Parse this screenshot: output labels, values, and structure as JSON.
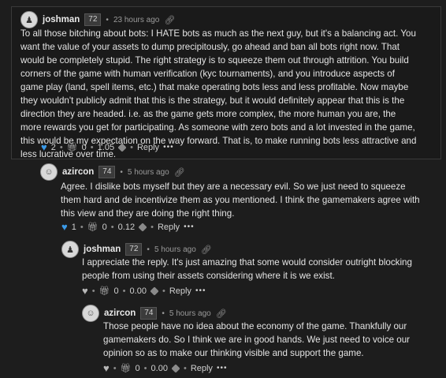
{
  "comments": [
    {
      "author": "joshman",
      "reputation": "72",
      "time": "23 hours ago",
      "body": "To all those bitching about bots: I HATE bots as much as the next guy, but it's a balancing act. You want the value of your assets to dump precipitously, go ahead and ban all bots right now. That would be completely stupid. The right strategy is to squeeze them out through attrition. You build corners of the game with human verification (kyc tournaments), and you introduce aspects of game play (land, spell items, etc.) that make operating bots less and less profitable. Now maybe they wouldn't publicly admit that this is the strategy, but it would definitely appear that this is the direction they are headed. i.e. as the game gets more complex, the more human you are, the more rewards you get for participating. As someone with zero bots and a lot invested in the game, this would be my expectation on the way forward. That is, to make running bots less attractive and less lucrative over time.",
      "votes": "2",
      "gifts": "0",
      "payout": "1.05",
      "liked": true,
      "reply_label": "Reply",
      "more_label": "•••"
    },
    {
      "author": "azircon",
      "reputation": "74",
      "time": "5 hours ago",
      "body": "Agree. I dislike bots myself but they are a necessary evil. So we just need to squeeze them hard and de incentivize them as you mentioned. I think the gamemakers agree with this view and they are doing the right thing.",
      "votes": "1",
      "gifts": "0",
      "payout": "0.12",
      "liked": true,
      "reply_label": "Reply",
      "more_label": "•••"
    },
    {
      "author": "joshman",
      "reputation": "72",
      "time": "5 hours ago",
      "body": "I appreciate the reply. It's just amazing that some would consider outright blocking people from using their assets considering where it is we exist.",
      "votes": "",
      "gifts": "0",
      "payout": "0.00",
      "liked": false,
      "reply_label": "Reply",
      "more_label": "•••"
    },
    {
      "author": "azircon",
      "reputation": "74",
      "time": "5 hours ago",
      "body": "Those people have no idea about the economy of the game. Thankfully our gamemakers do. So I think we are in good hands. We just need to voice our opinion so as to make our thinking visible and support the game.",
      "votes": "",
      "gifts": "0",
      "payout": "0.00",
      "liked": false,
      "reply_label": "Reply",
      "more_label": "•••"
    }
  ],
  "colors": {
    "liked": "#3b9ae8",
    "background": "#1d1d1d",
    "text": "#e6e6e6"
  },
  "icons": [
    "avatar",
    "link-icon",
    "heart-icon",
    "gift-icon",
    "hive-icon"
  ]
}
